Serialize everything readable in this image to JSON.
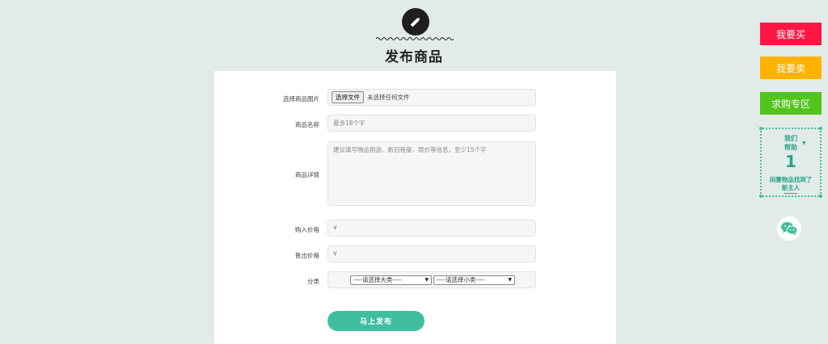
{
  "header": {
    "icon": "pencil-icon",
    "title": "发布商品"
  },
  "form": {
    "image_label": "选择商品图片",
    "file_button": "选择文件",
    "file_status": "未选择任何文件",
    "name_label": "商品名称",
    "name_placeholder": "最多18个字",
    "detail_label": "商品详情",
    "detail_placeholder": "建议填写物品用途、新旧程度、原价等信息，至少15个字",
    "buy_price_label": "购入价格",
    "buy_price_prefix": "¥",
    "sell_price_label": "售出价格",
    "sell_price_prefix": "¥",
    "category_label": "分类",
    "category_major": "----请选择大类----",
    "category_minor": "----请选择小类----",
    "submit_label": "马上发布"
  },
  "sidebar": {
    "buy_label": "我要买",
    "sell_label": "我要卖",
    "wanted_label": "求购专区",
    "help_line1": "我们",
    "help_line2": "帮助",
    "help_count": "1",
    "help_text1": "闲置物品找到了",
    "help_text2": "新主人",
    "wechat_icon": "wechat-icon"
  },
  "colors": {
    "background": "#e3ebe9",
    "accent": "#3fbf9f",
    "buy": "#ff1744",
    "sell": "#ffb300",
    "wanted": "#52c41a"
  }
}
